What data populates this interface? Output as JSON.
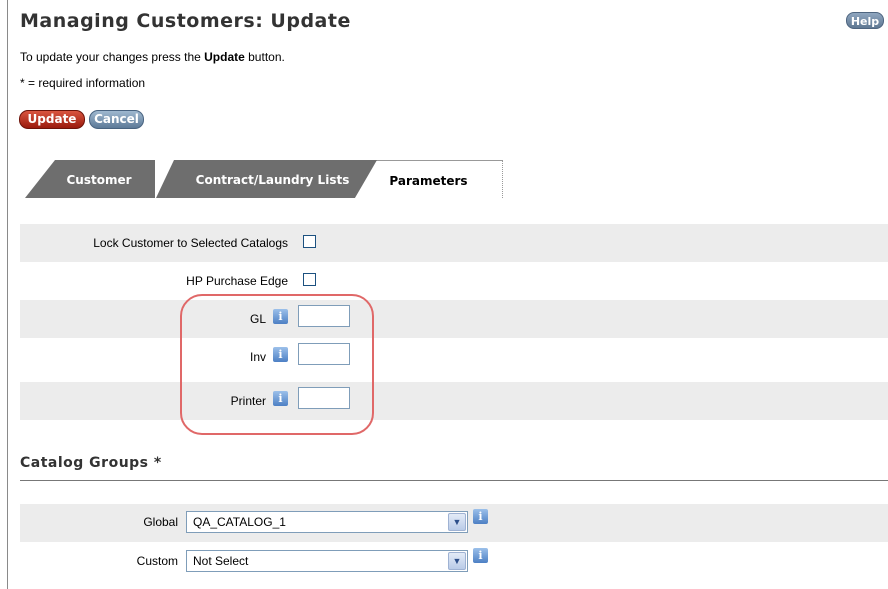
{
  "header": {
    "title": "Managing Customers: Update",
    "help_label": "Help"
  },
  "instructions": {
    "prefix": "To update your changes press the ",
    "bold": "Update",
    "suffix": " button.",
    "required_note": "* = required information"
  },
  "actions": {
    "update_label": "Update",
    "cancel_label": "Cancel"
  },
  "tabs": [
    {
      "label": "Customer",
      "active": false
    },
    {
      "label": "Contract/Laundry Lists",
      "active": false
    },
    {
      "label": "Parameters",
      "active": true
    }
  ],
  "parameters": {
    "lock_label": "Lock Customer to Selected Catalogs",
    "lock_checked": false,
    "hp_label": "HP Purchase Edge",
    "hp_checked": false,
    "gl_label": "GL",
    "gl_value": "",
    "inv_label": "Inv",
    "inv_value": "",
    "printer_label": "Printer",
    "printer_value": ""
  },
  "catalog_groups": {
    "title": "Catalog Groups *",
    "global_label": "Global",
    "global_value": "QA_CATALOG_1",
    "custom_label": "Custom",
    "custom_value": "Not Select"
  },
  "colors": {
    "update_button": "#b82a18",
    "cancel_button": "#7d97b3",
    "highlight": "#e06868",
    "tab_inactive": "#6e6e6e",
    "row_shade": "#ececec"
  },
  "icons": {
    "info": "info-icon",
    "dropdown": "chevron-down-icon"
  }
}
